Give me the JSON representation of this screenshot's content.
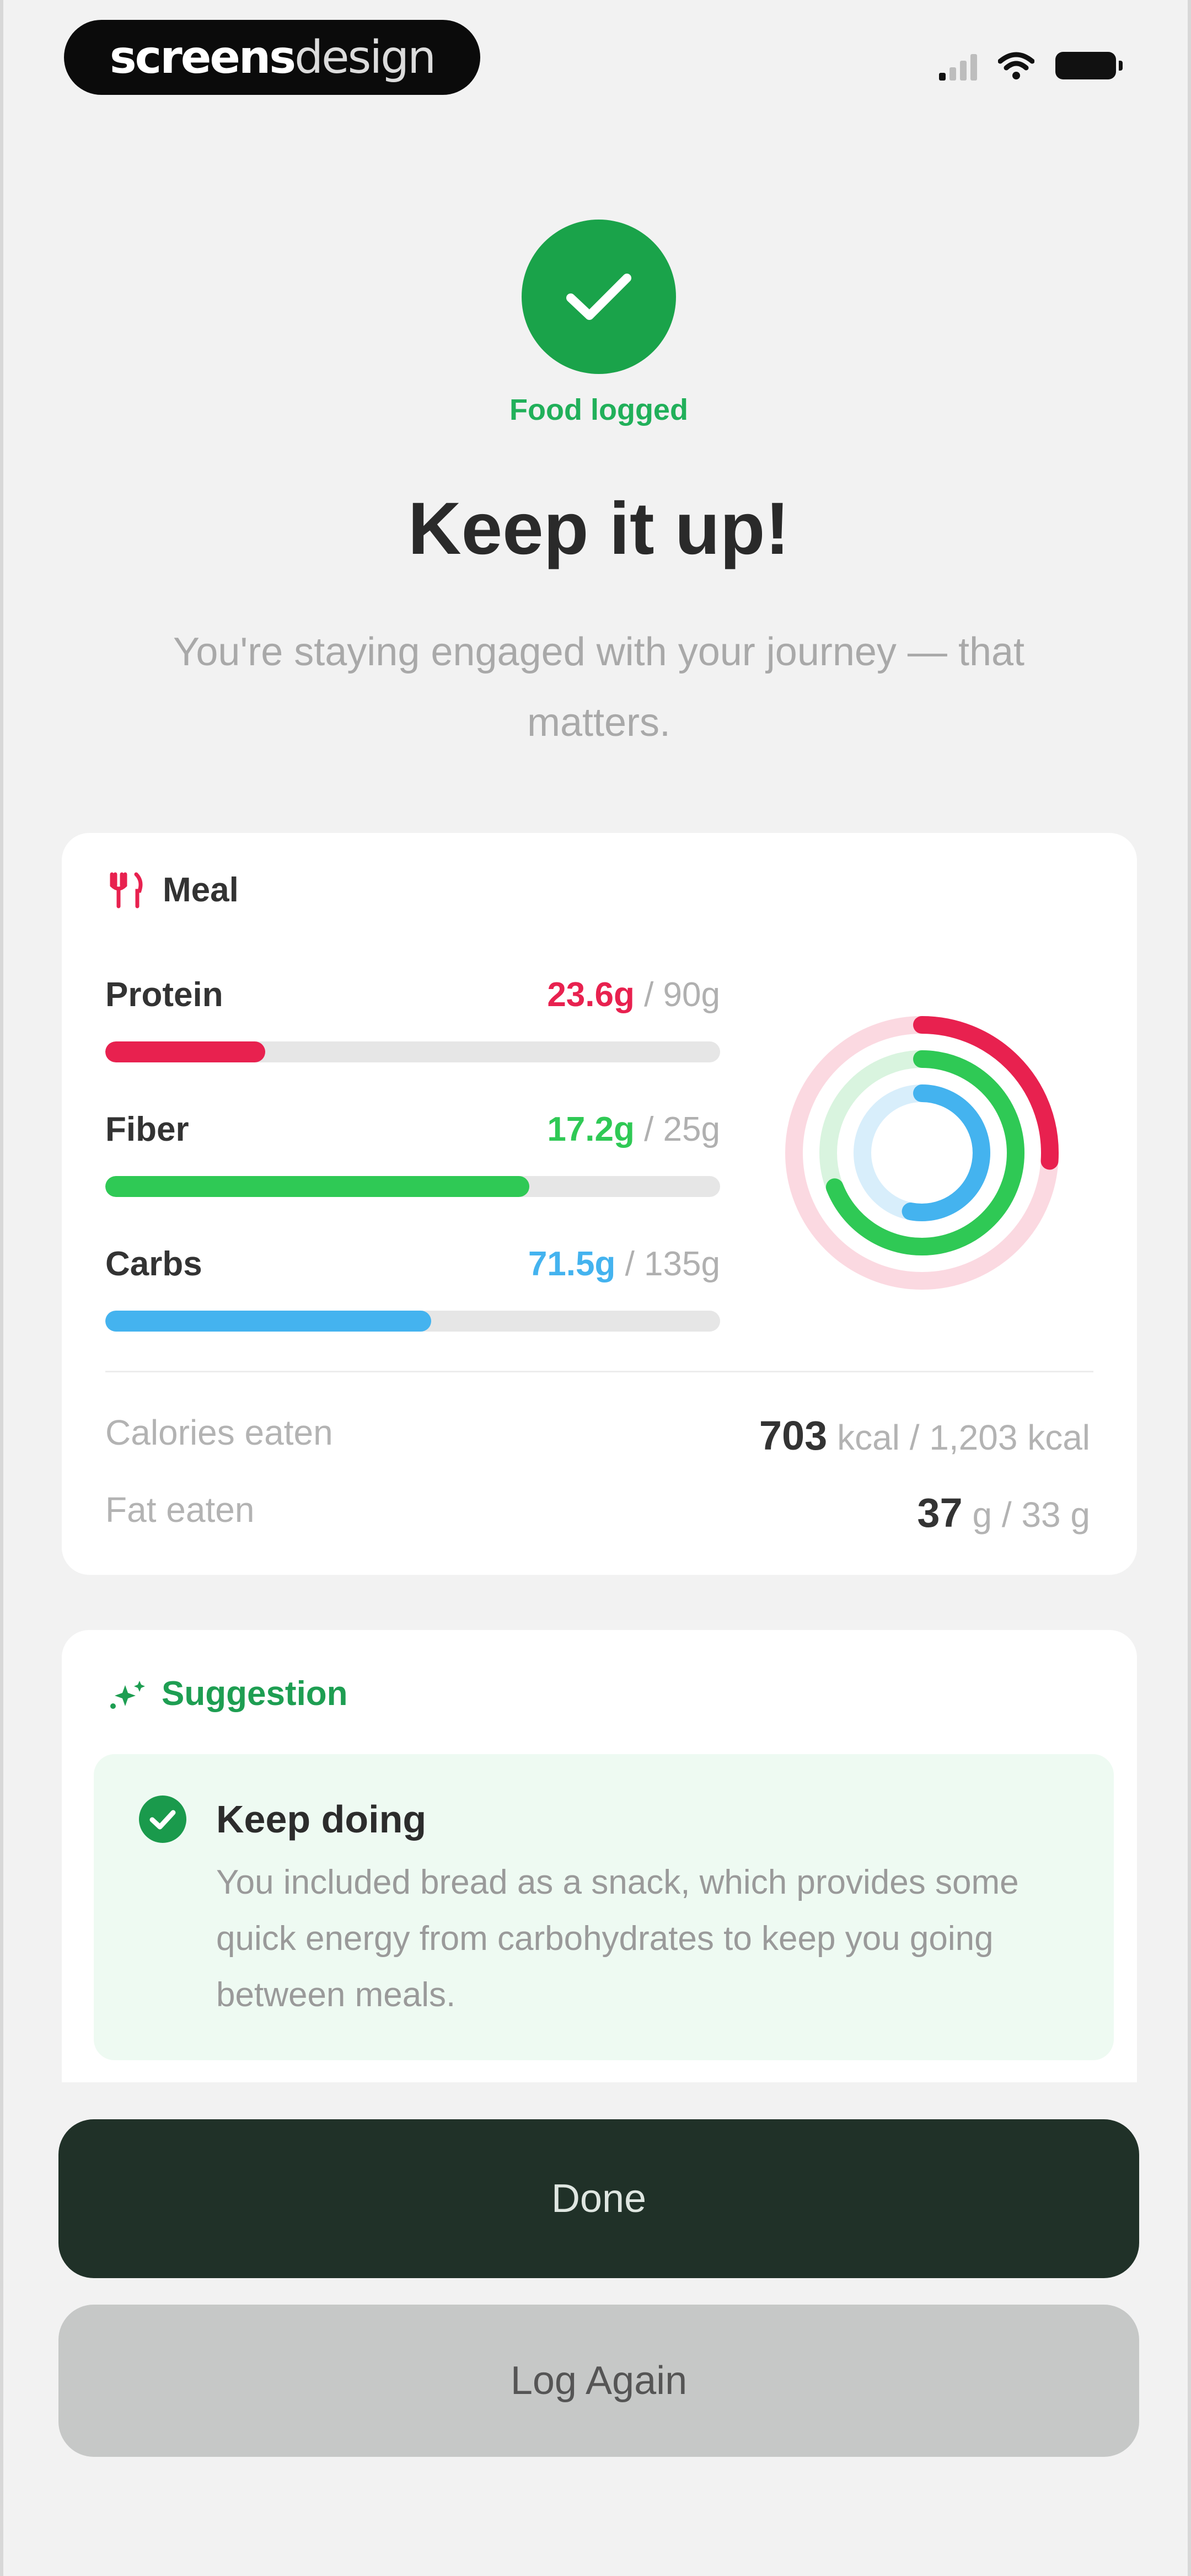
{
  "status_bar": {
    "brand_bold": "screens",
    "brand_light": "design",
    "signal_icon": "signal-icon",
    "wifi_icon": "wifi-icon",
    "battery_icon": "battery-icon"
  },
  "header": {
    "status_label": "Food logged",
    "title": "Keep it up!",
    "subtitle": "You're staying engaged with your journey — that matters."
  },
  "meal": {
    "title": "Meal",
    "icon": "utensils-icon",
    "macros": [
      {
        "name": "Protein",
        "current": "23.6g",
        "target": "/ 90g",
        "fraction": 0.26,
        "color": "#e8214f"
      },
      {
        "name": "Fiber",
        "current": "17.2g",
        "target": "/ 25g",
        "fraction": 0.69,
        "color": "#2fc955"
      },
      {
        "name": "Carbs",
        "current": "71.5g",
        "target": "/ 135g",
        "fraction": 0.53,
        "color": "#44b3ef"
      }
    ],
    "calories": {
      "label": "Calories eaten",
      "value": "703",
      "rest": "kcal / 1,203 kcal"
    },
    "fat": {
      "label": "Fat eaten",
      "value": "37",
      "rest": "g / 33 g"
    }
  },
  "suggestion": {
    "title": "Suggestion",
    "icon": "sparkle-icon",
    "heading": "Keep doing",
    "body": "You included bread as a snack, which provides some quick energy from carbohydrates to keep you going between meals."
  },
  "actions": {
    "done_label": "Done",
    "log_again_label": "Log Again"
  },
  "colors": {
    "accent_green": "#1aa34a",
    "dark_button": "#203128",
    "light_button": "#c6c8c7"
  }
}
